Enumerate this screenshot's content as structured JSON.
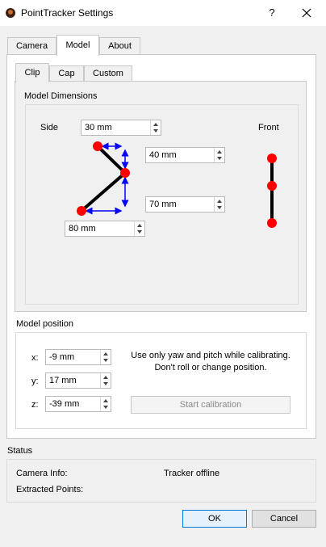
{
  "window": {
    "title": "PointTracker Settings",
    "help_label": "?"
  },
  "outer_tabs": [
    {
      "label": "Camera"
    },
    {
      "label": "Model"
    },
    {
      "label": "About"
    }
  ],
  "inner_tabs": [
    {
      "label": "Clip"
    },
    {
      "label": "Cap"
    },
    {
      "label": "Custom"
    }
  ],
  "model_dimensions": {
    "title": "Model Dimensions",
    "side_label": "Side",
    "front_label": "Front",
    "side_value": "30 mm",
    "top_value": "40 mm",
    "bottom_value": "70 mm",
    "depth_value": "80 mm"
  },
  "model_position": {
    "title": "Model position",
    "x_label": "x:",
    "y_label": "y:",
    "z_label": "z:",
    "x_value": "-9 mm",
    "y_value": "17 mm",
    "z_value": "-39 mm",
    "hint_line1": "Use only yaw and pitch while calibrating.",
    "hint_line2": "Don't roll or change position.",
    "calibrate_label": "Start calibration"
  },
  "status": {
    "title": "Status",
    "camera_info_label": "Camera Info:",
    "camera_info_value": "Tracker offline",
    "extracted_points_label": "Extracted Points:"
  },
  "buttons": {
    "ok": "OK",
    "cancel": "Cancel"
  },
  "colors": {
    "point": "#ff0000",
    "arrow": "#0000ff",
    "link": "#000000",
    "focus": "#0078d7"
  },
  "icons": {
    "app": "pointtracker-app-icon",
    "close": "close-icon",
    "spin_up": "spin-up-arrow",
    "spin_down": "spin-down-arrow"
  }
}
